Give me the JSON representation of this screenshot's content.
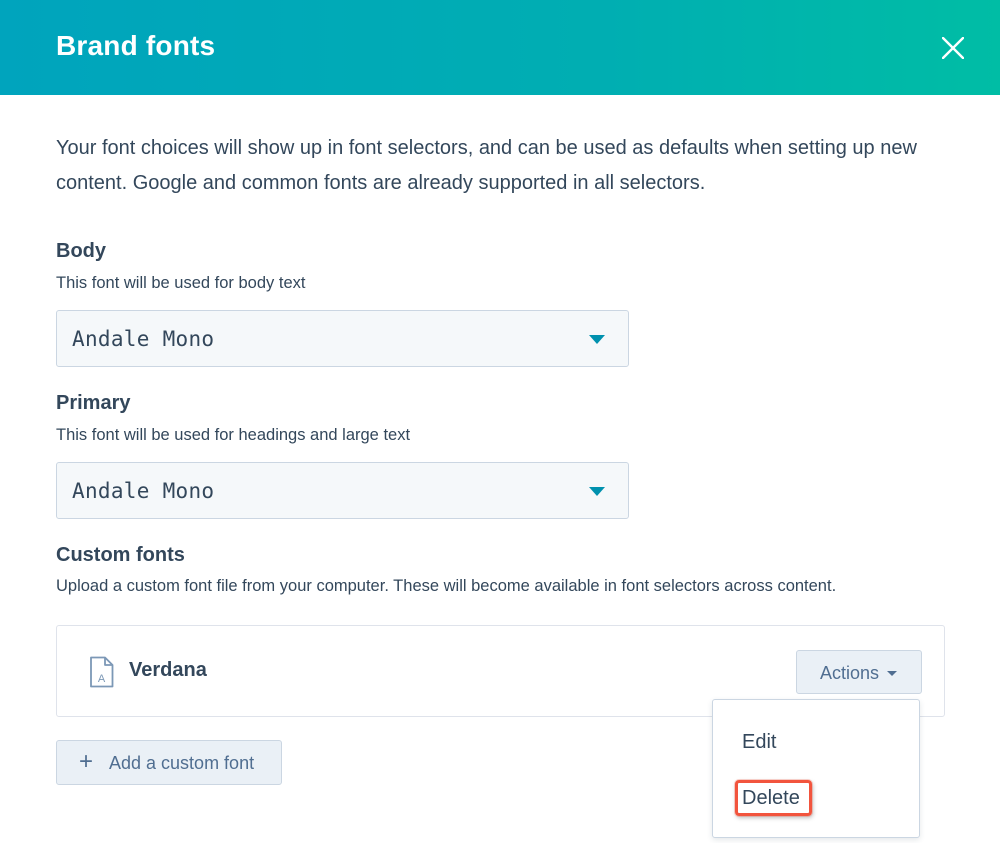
{
  "dialog": {
    "title": "Brand fonts",
    "intro": "Your font choices will show up in font selectors, and can be used as defaults when setting up new content. Google and common fonts are already supported in all selectors."
  },
  "body_font": {
    "title": "Body",
    "subtitle": "This font will be used for body text",
    "value": "Andale Mono"
  },
  "primary_font": {
    "title": "Primary",
    "subtitle": "This font will be used for headings and large text",
    "value": "Andale Mono"
  },
  "custom_fonts": {
    "title": "Custom fonts",
    "subtitle": "Upload a custom font file from your computer. These will become available in font selectors across content.",
    "items": [
      {
        "name": "Verdana",
        "icon": "font-file-icon",
        "actions_label": "Actions"
      }
    ],
    "add_button_label": "Add a custom font"
  },
  "actions_menu": {
    "items": [
      {
        "label": "Edit"
      },
      {
        "label": "Delete",
        "highlighted": true
      }
    ]
  },
  "colors": {
    "header_gradient_start": "#00a4bd",
    "header_gradient_end": "#00bda5",
    "text": "#33475b",
    "accent": "#0091ae",
    "highlight": "#f2543d"
  }
}
